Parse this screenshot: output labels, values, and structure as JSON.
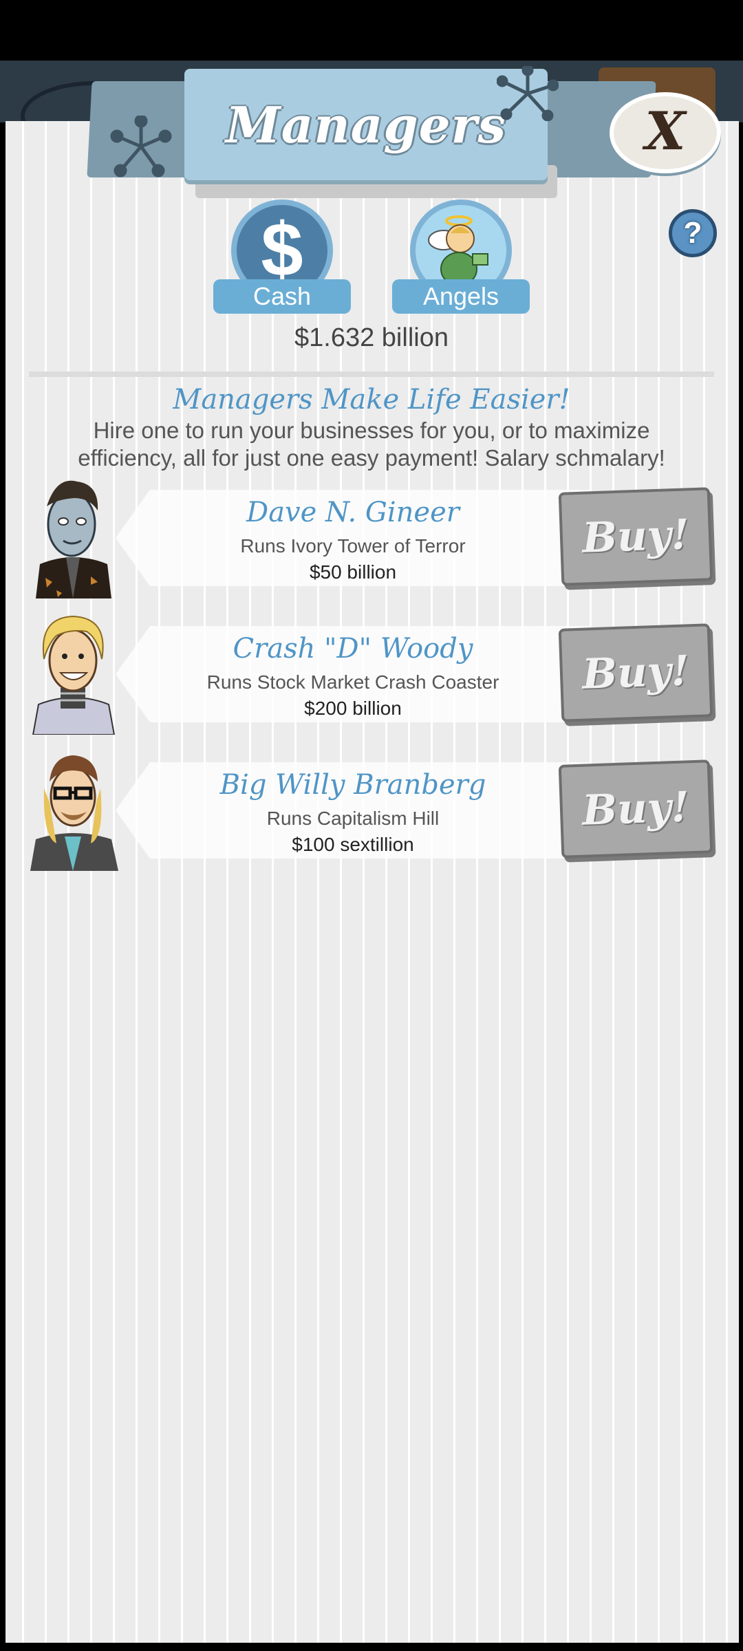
{
  "header": {
    "title": "Managers",
    "close_label": "X",
    "help_label": "?"
  },
  "tabs": [
    {
      "label": "Cash",
      "icon": "dollar-icon",
      "glyph": "$"
    },
    {
      "label": "Angels",
      "icon": "angel-icon"
    }
  ],
  "balance": "$1.632 billion",
  "intro": {
    "headline": "Managers Make Life Easier!",
    "text": "Hire one to run your businesses for you, or to maximize efficiency, all for just one easy payment! Salary schmalary!"
  },
  "managers": [
    {
      "name": "Dave N. Gineer",
      "runs": "Runs Ivory Tower of Terror",
      "cost": "$50 billion",
      "buy_label": "Buy!"
    },
    {
      "name": "Crash \"D\" Woody",
      "runs": "Runs Stock Market Crash Coaster",
      "cost": "$200 billion",
      "buy_label": "Buy!"
    },
    {
      "name": "Big Willy Branberg",
      "runs": "Runs Capitalism Hill",
      "cost": "$100 sextillion",
      "buy_label": "Buy!"
    }
  ],
  "colors": {
    "accent_blue": "#4f95c6",
    "banner": "#a9cce0",
    "button_disabled": "#a8a8a8"
  }
}
